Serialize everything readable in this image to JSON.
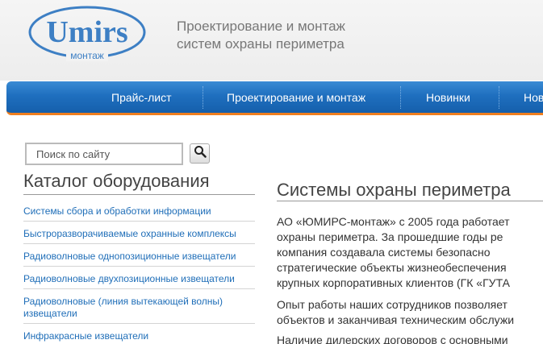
{
  "header": {
    "logo_text": "Umirs",
    "logo_subtext": "монтаж",
    "tagline_line1": "Проектирование и монтаж",
    "tagline_line2": "систем охраны периметра"
  },
  "nav": {
    "items": [
      {
        "label": "Прайс-лист"
      },
      {
        "label": "Проектирование и монтаж"
      },
      {
        "label": "Новинки"
      },
      {
        "label": "Нов"
      }
    ]
  },
  "search": {
    "placeholder": "Поиск по сайту",
    "button_icon": "search-icon"
  },
  "catalog": {
    "title": "Каталог оборудования",
    "items": [
      {
        "label": "Системы сбора и обработки информации"
      },
      {
        "label": "Быстроразворачиваемые охранные комплексы"
      },
      {
        "label": "Радиоволновые однопозиционные извещатели"
      },
      {
        "label": "Радиоволновые двухпозиционные извещатели"
      },
      {
        "label": "Радиоволновые (линия вытекающей волны) извещатели"
      },
      {
        "label": "Инфракрасные извещатели"
      }
    ]
  },
  "main": {
    "title": "Системы охраны периметра",
    "paragraph1": [
      "АО «ЮМИРС-монтаж» с 2005 года работает",
      "охраны периметра.  За прошедшие годы ре",
      "компания создавала системы безопасно",
      "стратегические объекты жизнеобеспечения",
      "крупных корпоративных клиентов (ГК «ГУТА"
    ],
    "paragraph2": [
      "Опыт работы наших сотрудников позволяет",
      "объектов и заканчивая техническим обслужи"
    ],
    "paragraph3": [
      "Наличие дилерских договоров с основными"
    ]
  },
  "colors": {
    "brand_blue": "#1f6fbf",
    "nav_accent": "#f07f1e",
    "link": "#1f6eb8"
  }
}
